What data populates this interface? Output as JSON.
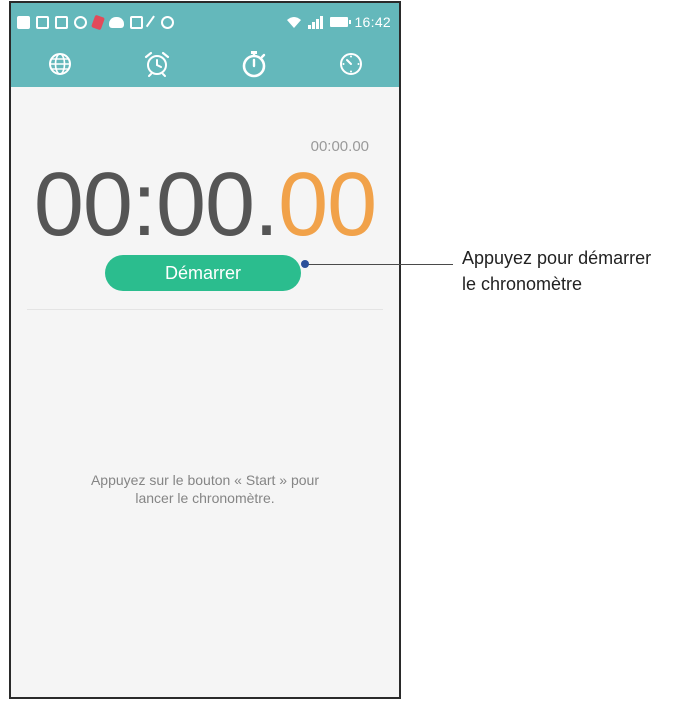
{
  "status_bar": {
    "time": "16:42"
  },
  "tabs": [
    {
      "name": "world-clock",
      "icon": "globe-icon"
    },
    {
      "name": "alarm",
      "icon": "alarm-clock-icon"
    },
    {
      "name": "stopwatch",
      "icon": "stopwatch-icon",
      "selected": true
    },
    {
      "name": "timer",
      "icon": "timer-icon"
    }
  ],
  "stopwatch": {
    "reference_time": "00:00.00",
    "main_time_minutes_seconds": "00:00.",
    "main_time_centiseconds": "00",
    "start_button_label": "Démarrer",
    "hint_line1": "Appuyez sur le bouton « Start » pour",
    "hint_line2": "lancer le chronomètre."
  },
  "callout": {
    "line1": "Appuyez pour démarrer",
    "line2": "le chronomètre"
  },
  "colors": {
    "header": "#64b8bb",
    "start_button": "#2bbd8e",
    "centiseconds": "#f1a24a",
    "callout_dot": "#2b4f9a"
  }
}
